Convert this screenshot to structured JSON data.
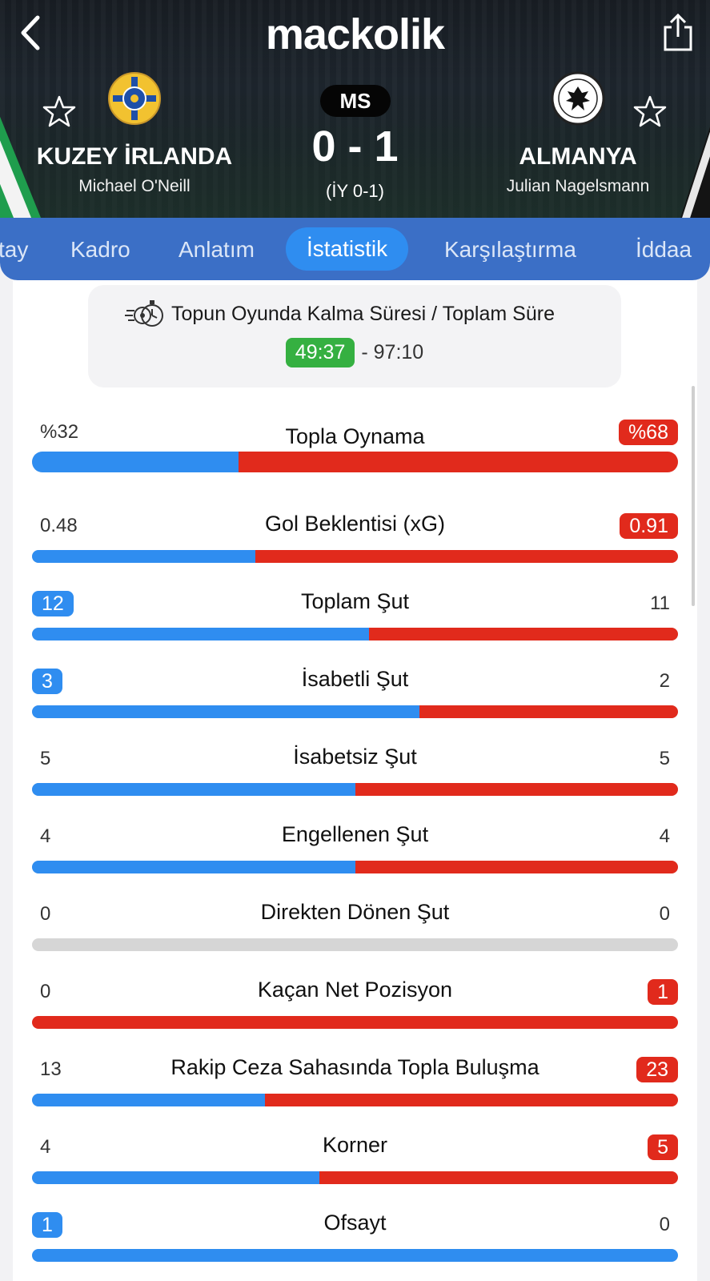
{
  "header": {
    "logo": "mackolik",
    "status": "MS",
    "score": "0 - 1",
    "halftime": "(İY 0-1)",
    "home": {
      "name": "KUZEY İRLANDA",
      "coach": "Michael O'Neill",
      "color": "#1f9d4d"
    },
    "away": {
      "name": "ALMANYA",
      "coach": "Julian Nagelsmann",
      "color": "#141414"
    }
  },
  "tabs": [
    {
      "label": "tay",
      "active": false
    },
    {
      "label": "Kadro",
      "active": false
    },
    {
      "label": "Anlatım",
      "active": false
    },
    {
      "label": "İstatistik",
      "active": true
    },
    {
      "label": "Karşılaştırma",
      "active": false
    },
    {
      "label": "İddaa",
      "active": false
    }
  ],
  "possession_time": {
    "title": "Topun Oyunda Kalma Süresi / Toplam Süre",
    "played": "49:37",
    "total": "- 97:10"
  },
  "colors": {
    "home": "#2f8df0",
    "away": "#e12a1c",
    "neutral": "#d6d6d6",
    "played_badge": "#35b041"
  },
  "stats": [
    {
      "label": "Topla Oynama",
      "home": "%32",
      "away": "%68",
      "home_value": 32,
      "away_value": 68,
      "leader": "away"
    },
    {
      "label": "Gol Beklentisi (xG)",
      "home": "0.48",
      "away": "0.91",
      "home_value": 0.48,
      "away_value": 0.91,
      "leader": "away"
    },
    {
      "label": "Toplam Şut",
      "home": "12",
      "away": "11",
      "home_value": 12,
      "away_value": 11,
      "leader": "home"
    },
    {
      "label": "İsabetli Şut",
      "home": "3",
      "away": "2",
      "home_value": 3,
      "away_value": 2,
      "leader": "home"
    },
    {
      "label": "İsabetsiz Şut",
      "home": "5",
      "away": "5",
      "home_value": 5,
      "away_value": 5,
      "leader": "none"
    },
    {
      "label": "Engellenen Şut",
      "home": "4",
      "away": "4",
      "home_value": 4,
      "away_value": 4,
      "leader": "none"
    },
    {
      "label": "Direkten Dönen Şut",
      "home": "0",
      "away": "0",
      "home_value": 0,
      "away_value": 0,
      "leader": "none"
    },
    {
      "label": "Kaçan Net Pozisyon",
      "home": "0",
      "away": "1",
      "home_value": 0,
      "away_value": 1,
      "leader": "away"
    },
    {
      "label": "Rakip Ceza Sahasında Topla Buluşma",
      "home": "13",
      "away": "23",
      "home_value": 13,
      "away_value": 23,
      "leader": "away"
    },
    {
      "label": "Korner",
      "home": "4",
      "away": "5",
      "home_value": 4,
      "away_value": 5,
      "leader": "away"
    },
    {
      "label": "Ofsayt",
      "home": "1",
      "away": "0",
      "home_value": 1,
      "away_value": 0,
      "leader": "home"
    }
  ]
}
